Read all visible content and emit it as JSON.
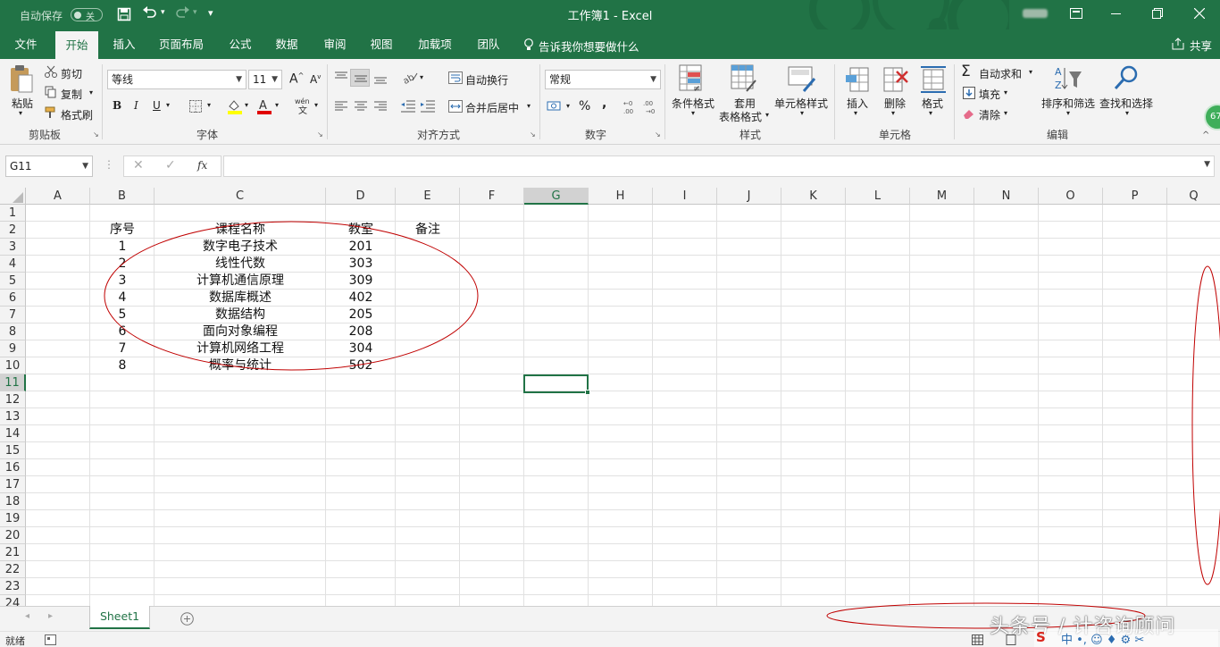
{
  "titlebar": {
    "autosave_label": "自动保存",
    "autosave_state": "关",
    "title": "工作簿1 - Excel"
  },
  "tabs": [
    {
      "label": "文件",
      "id": "file"
    },
    {
      "label": "开始",
      "id": "home"
    },
    {
      "label": "插入",
      "id": "insert"
    },
    {
      "label": "页面布局",
      "id": "pagelayout"
    },
    {
      "label": "公式",
      "id": "formulas"
    },
    {
      "label": "数据",
      "id": "data"
    },
    {
      "label": "审阅",
      "id": "review"
    },
    {
      "label": "视图",
      "id": "view"
    },
    {
      "label": "加载项",
      "id": "addins"
    },
    {
      "label": "团队",
      "id": "team"
    }
  ],
  "tell_me": "告诉我你想要做什么",
  "share": "共享",
  "ribbon": {
    "clipboard": {
      "paste": "粘贴",
      "cut": "剪切",
      "copy": "复制",
      "format_painter": "格式刷",
      "group": "剪贴板"
    },
    "font": {
      "font_name": "等线",
      "font_size": "11",
      "bold": "B",
      "italic": "I",
      "underline": "U",
      "group": "字体"
    },
    "alignment": {
      "wrap": "自动换行",
      "merge": "合并后居中",
      "group": "对齐方式"
    },
    "number": {
      "format": "常规",
      "percent": "%",
      "comma": ",",
      "group": "数字"
    },
    "styles": {
      "conditional": "条件格式",
      "table_line1": "套用",
      "table_line2": "表格格式",
      "cell_styles": "单元格样式",
      "group": "样式"
    },
    "cells": {
      "insert": "插入",
      "delete": "删除",
      "format": "格式",
      "group": "单元格"
    },
    "editing": {
      "autosum": "自动求和",
      "fill": "填充",
      "clear": "清除",
      "sort": "排序和筛选",
      "find": "查找和选择",
      "group": "编辑"
    },
    "badge": "67"
  },
  "formula_bar": {
    "name_box": "G11",
    "fx": "fx",
    "value": ""
  },
  "columns": [
    "A",
    "B",
    "C",
    "D",
    "E",
    "F",
    "G",
    "H",
    "I",
    "J",
    "K",
    "L",
    "M",
    "N",
    "O",
    "P",
    "Q"
  ],
  "rows": [
    "1",
    "2",
    "3",
    "4",
    "5",
    "6",
    "7",
    "8",
    "9",
    "10",
    "11",
    "12",
    "13",
    "14",
    "15",
    "16",
    "17",
    "18",
    "19",
    "20",
    "21",
    "22",
    "23",
    "24"
  ],
  "table": {
    "headers": {
      "b": "序号",
      "c": "课程名称",
      "d": "教室",
      "e": "备注"
    },
    "rows": [
      {
        "b": "1",
        "c": "数字电子技术",
        "d": "201"
      },
      {
        "b": "2",
        "c": "线性代数",
        "d": "303"
      },
      {
        "b": "3",
        "c": "计算机通信原理",
        "d": "309"
      },
      {
        "b": "4",
        "c": "数据库概述",
        "d": "402"
      },
      {
        "b": "5",
        "c": "数据结构",
        "d": "205"
      },
      {
        "b": "6",
        "c": "面向对象编程",
        "d": "208"
      },
      {
        "b": "7",
        "c": "计算机网络工程",
        "d": "304"
      },
      {
        "b": "8",
        "c": "概率与统计",
        "d": "502"
      }
    ]
  },
  "selected_cell": "G11",
  "sheets": [
    {
      "name": "Sheet1",
      "active": true
    }
  ],
  "status": {
    "ready": "就绪"
  },
  "watermark": "头条号 / 计咨询顾问",
  "colors": {
    "accent": "#217346",
    "annotation": "#c00000",
    "selection": "#217346"
  }
}
